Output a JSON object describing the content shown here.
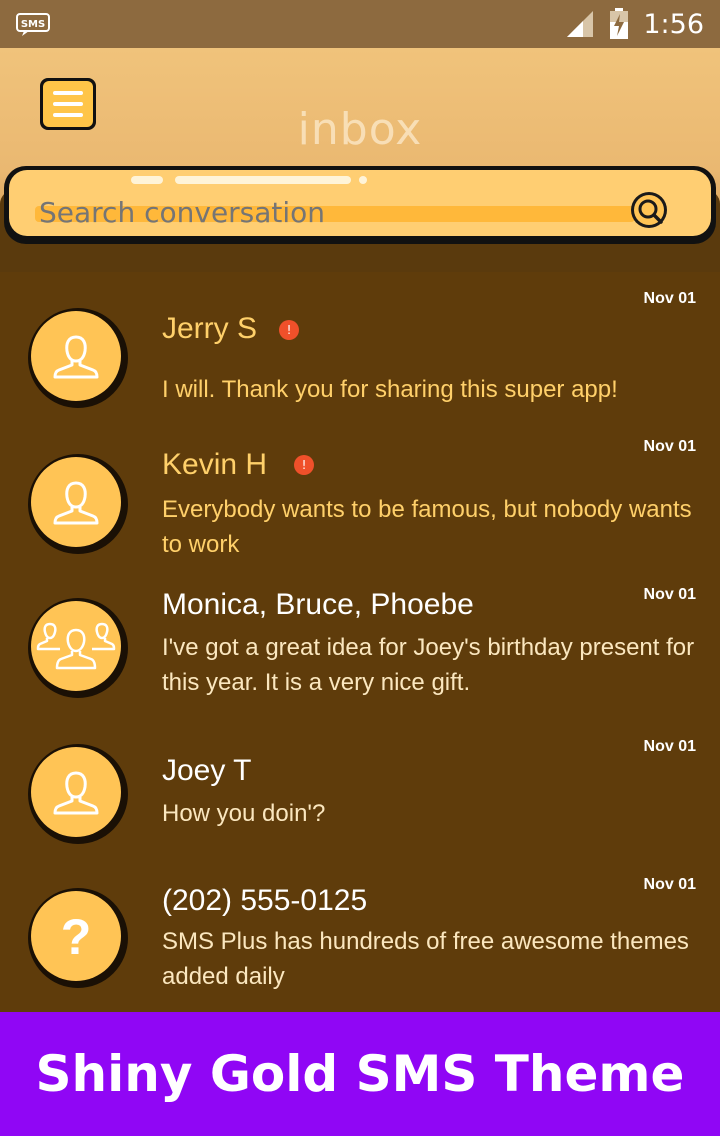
{
  "status_bar": {
    "time": "1:56",
    "notification_icon": "sms-icon",
    "icons": [
      "signal-icon",
      "battery-icon"
    ]
  },
  "header": {
    "title": "inbox",
    "menu_icon": "hamburger-menu-icon"
  },
  "search": {
    "placeholder": "Search conversation",
    "icon": "search-icon"
  },
  "conversations": [
    {
      "name": "Jerry S",
      "unread": true,
      "unread_mark": "!",
      "snippet": "I will. Thank you for sharing this super app!",
      "date": "Nov 01",
      "avatar": "person-icon"
    },
    {
      "name": "Kevin H",
      "unread": true,
      "unread_mark": "!",
      "snippet": "Everybody wants to be famous, but nobody wants to work",
      "date": "Nov 01",
      "avatar": "person-icon"
    },
    {
      "name": "Monica, Bruce, Phoebe",
      "unread": false,
      "snippet": "I've got a great idea for Joey's birthday present for this year. It is a very nice gift.",
      "date": "Nov 01",
      "avatar": "group-icon"
    },
    {
      "name": "Joey T",
      "unread": false,
      "snippet": "How you doin'?",
      "date": "Nov 01",
      "avatar": "person-icon"
    },
    {
      "name": "(202) 555-0125",
      "unread": false,
      "snippet": "SMS Plus has hundreds of free awesome themes added daily",
      "date": "Nov 01",
      "avatar": "question-mark-icon"
    }
  ],
  "banner": {
    "text": "Shiny Gold SMS Theme"
  },
  "colors": {
    "background": "#5f3c0b",
    "header": "#eab871",
    "accent": "#ffc455",
    "unread_name": "#ffd06a",
    "read_name": "#ffffff",
    "unread_snippet": "#ffd06a",
    "read_snippet": "#fbe7bf",
    "unread_dot": "#f0502a",
    "banner": "#9006f5"
  }
}
